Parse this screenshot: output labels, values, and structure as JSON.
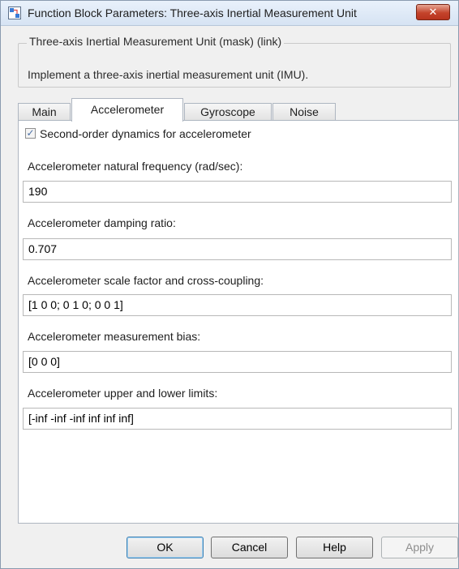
{
  "window": {
    "title": "Function Block Parameters: Three-axis Inertial Measurement Unit",
    "close_glyph": "✕"
  },
  "mask": {
    "group_label": "Three-axis Inertial Measurement Unit (mask) (link)",
    "description": "Implement a three-axis inertial measurement unit (IMU)."
  },
  "tabs": [
    {
      "label": "Main",
      "active": false
    },
    {
      "label": "Accelerometer",
      "active": true
    },
    {
      "label": "Gyroscope",
      "active": false
    },
    {
      "label": "Noise",
      "active": false
    }
  ],
  "accelerometer": {
    "second_order": {
      "label": "Second-order dynamics for accelerometer",
      "checked": true,
      "check_glyph": "✓"
    },
    "fields": [
      {
        "label": "Accelerometer natural frequency (rad/sec):",
        "value": "190"
      },
      {
        "label": "Accelerometer damping ratio:",
        "value": "0.707"
      },
      {
        "label": "Accelerometer scale factor and cross-coupling:",
        "value": "[1 0 0; 0 1 0; 0 0 1]"
      },
      {
        "label": "Accelerometer measurement bias:",
        "value": "[0 0 0]"
      },
      {
        "label": "Accelerometer upper and lower limits:",
        "value": "[-inf  -inf  -inf  inf inf inf]"
      }
    ]
  },
  "buttons": {
    "ok": "OK",
    "cancel": "Cancel",
    "help": "Help",
    "apply": "Apply"
  },
  "colors": {
    "close_button": "#c4432b",
    "checkbox_check": "#4a6fa5",
    "default_button_border": "#3c7fb1"
  }
}
